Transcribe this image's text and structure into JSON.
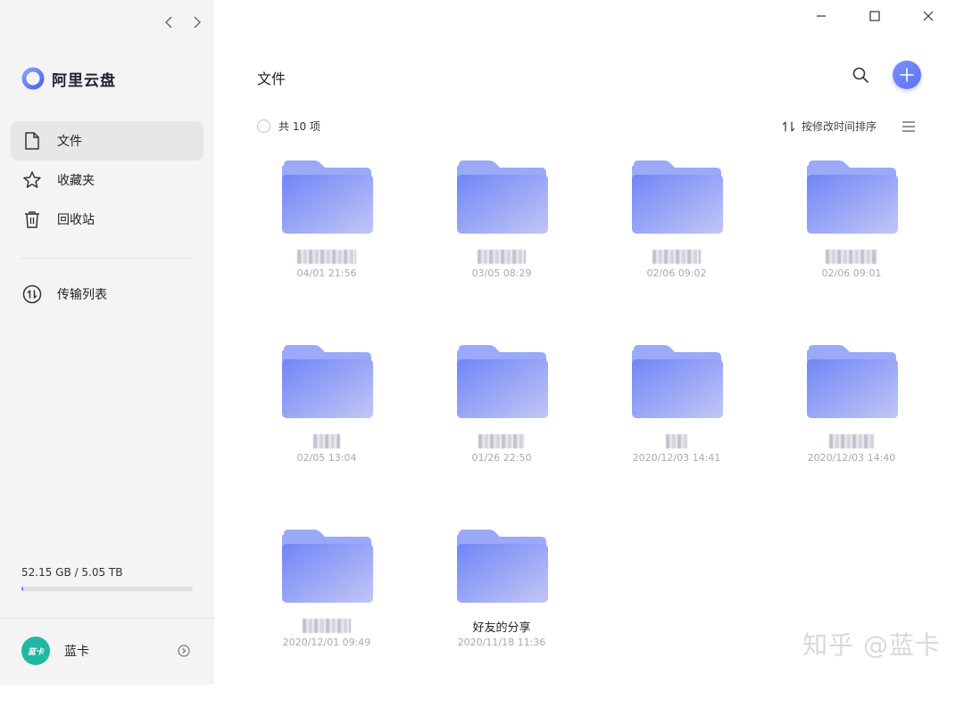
{
  "sidebar": {
    "app_name": "阿里云盘",
    "menu": [
      {
        "label": "文件",
        "icon": "file-icon",
        "active": true
      },
      {
        "label": "收藏夹",
        "icon": "star-icon"
      },
      {
        "label": "回收站",
        "icon": "trash-icon"
      }
    ],
    "transfer_label": "传输列表",
    "storage": {
      "text": "52.15 GB / 5.05 TB",
      "used_fraction": 0.01
    },
    "user": {
      "name": "蓝卡",
      "avatar_text": "蓝卡"
    }
  },
  "header": {
    "title": "文件"
  },
  "toolbar": {
    "count_label": "共 10 项",
    "sort_label": "按修改时间排序"
  },
  "files": [
    {
      "name": "",
      "date": "04/01 21:56"
    },
    {
      "name": "",
      "date": "03/05 08:29"
    },
    {
      "name": "",
      "date": "02/06 09:02"
    },
    {
      "name": "",
      "date": "02/06 09:01"
    },
    {
      "name": "",
      "date": "02/05 13:04"
    },
    {
      "name": "",
      "date": "01/26 22:50"
    },
    {
      "name": "",
      "date": "2020/12/03 14:41"
    },
    {
      "name": "",
      "date": "2020/12/03 14:40"
    },
    {
      "name": "",
      "date": "2020/12/01 09:49"
    },
    {
      "name": "好友的分享",
      "date": "2020/11/18 11:36"
    }
  ],
  "watermark": "知乎 @蓝卡",
  "colors": {
    "accent": "#5f73f3",
    "folder_front": "#7b8ff8",
    "folder_back": "#9aa7f7",
    "avatar": "#1fb8a3"
  }
}
